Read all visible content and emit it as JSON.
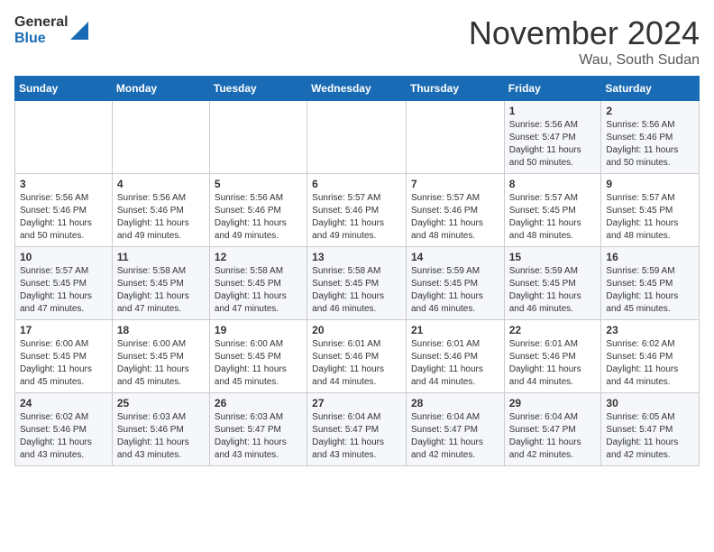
{
  "header": {
    "logo_general": "General",
    "logo_blue": "Blue",
    "month_title": "November 2024",
    "subtitle": "Wau, South Sudan"
  },
  "days_of_week": [
    "Sunday",
    "Monday",
    "Tuesday",
    "Wednesday",
    "Thursday",
    "Friday",
    "Saturday"
  ],
  "weeks": [
    [
      {
        "day": "",
        "info": ""
      },
      {
        "day": "",
        "info": ""
      },
      {
        "day": "",
        "info": ""
      },
      {
        "day": "",
        "info": ""
      },
      {
        "day": "",
        "info": ""
      },
      {
        "day": "1",
        "info": "Sunrise: 5:56 AM\nSunset: 5:47 PM\nDaylight: 11 hours and 50 minutes."
      },
      {
        "day": "2",
        "info": "Sunrise: 5:56 AM\nSunset: 5:46 PM\nDaylight: 11 hours and 50 minutes."
      }
    ],
    [
      {
        "day": "3",
        "info": "Sunrise: 5:56 AM\nSunset: 5:46 PM\nDaylight: 11 hours and 50 minutes."
      },
      {
        "day": "4",
        "info": "Sunrise: 5:56 AM\nSunset: 5:46 PM\nDaylight: 11 hours and 49 minutes."
      },
      {
        "day": "5",
        "info": "Sunrise: 5:56 AM\nSunset: 5:46 PM\nDaylight: 11 hours and 49 minutes."
      },
      {
        "day": "6",
        "info": "Sunrise: 5:57 AM\nSunset: 5:46 PM\nDaylight: 11 hours and 49 minutes."
      },
      {
        "day": "7",
        "info": "Sunrise: 5:57 AM\nSunset: 5:46 PM\nDaylight: 11 hours and 48 minutes."
      },
      {
        "day": "8",
        "info": "Sunrise: 5:57 AM\nSunset: 5:45 PM\nDaylight: 11 hours and 48 minutes."
      },
      {
        "day": "9",
        "info": "Sunrise: 5:57 AM\nSunset: 5:45 PM\nDaylight: 11 hours and 48 minutes."
      }
    ],
    [
      {
        "day": "10",
        "info": "Sunrise: 5:57 AM\nSunset: 5:45 PM\nDaylight: 11 hours and 47 minutes."
      },
      {
        "day": "11",
        "info": "Sunrise: 5:58 AM\nSunset: 5:45 PM\nDaylight: 11 hours and 47 minutes."
      },
      {
        "day": "12",
        "info": "Sunrise: 5:58 AM\nSunset: 5:45 PM\nDaylight: 11 hours and 47 minutes."
      },
      {
        "day": "13",
        "info": "Sunrise: 5:58 AM\nSunset: 5:45 PM\nDaylight: 11 hours and 46 minutes."
      },
      {
        "day": "14",
        "info": "Sunrise: 5:59 AM\nSunset: 5:45 PM\nDaylight: 11 hours and 46 minutes."
      },
      {
        "day": "15",
        "info": "Sunrise: 5:59 AM\nSunset: 5:45 PM\nDaylight: 11 hours and 46 minutes."
      },
      {
        "day": "16",
        "info": "Sunrise: 5:59 AM\nSunset: 5:45 PM\nDaylight: 11 hours and 45 minutes."
      }
    ],
    [
      {
        "day": "17",
        "info": "Sunrise: 6:00 AM\nSunset: 5:45 PM\nDaylight: 11 hours and 45 minutes."
      },
      {
        "day": "18",
        "info": "Sunrise: 6:00 AM\nSunset: 5:45 PM\nDaylight: 11 hours and 45 minutes."
      },
      {
        "day": "19",
        "info": "Sunrise: 6:00 AM\nSunset: 5:45 PM\nDaylight: 11 hours and 45 minutes."
      },
      {
        "day": "20",
        "info": "Sunrise: 6:01 AM\nSunset: 5:46 PM\nDaylight: 11 hours and 44 minutes."
      },
      {
        "day": "21",
        "info": "Sunrise: 6:01 AM\nSunset: 5:46 PM\nDaylight: 11 hours and 44 minutes."
      },
      {
        "day": "22",
        "info": "Sunrise: 6:01 AM\nSunset: 5:46 PM\nDaylight: 11 hours and 44 minutes."
      },
      {
        "day": "23",
        "info": "Sunrise: 6:02 AM\nSunset: 5:46 PM\nDaylight: 11 hours and 44 minutes."
      }
    ],
    [
      {
        "day": "24",
        "info": "Sunrise: 6:02 AM\nSunset: 5:46 PM\nDaylight: 11 hours and 43 minutes."
      },
      {
        "day": "25",
        "info": "Sunrise: 6:03 AM\nSunset: 5:46 PM\nDaylight: 11 hours and 43 minutes."
      },
      {
        "day": "26",
        "info": "Sunrise: 6:03 AM\nSunset: 5:47 PM\nDaylight: 11 hours and 43 minutes."
      },
      {
        "day": "27",
        "info": "Sunrise: 6:04 AM\nSunset: 5:47 PM\nDaylight: 11 hours and 43 minutes."
      },
      {
        "day": "28",
        "info": "Sunrise: 6:04 AM\nSunset: 5:47 PM\nDaylight: 11 hours and 42 minutes."
      },
      {
        "day": "29",
        "info": "Sunrise: 6:04 AM\nSunset: 5:47 PM\nDaylight: 11 hours and 42 minutes."
      },
      {
        "day": "30",
        "info": "Sunrise: 6:05 AM\nSunset: 5:47 PM\nDaylight: 11 hours and 42 minutes."
      }
    ]
  ]
}
